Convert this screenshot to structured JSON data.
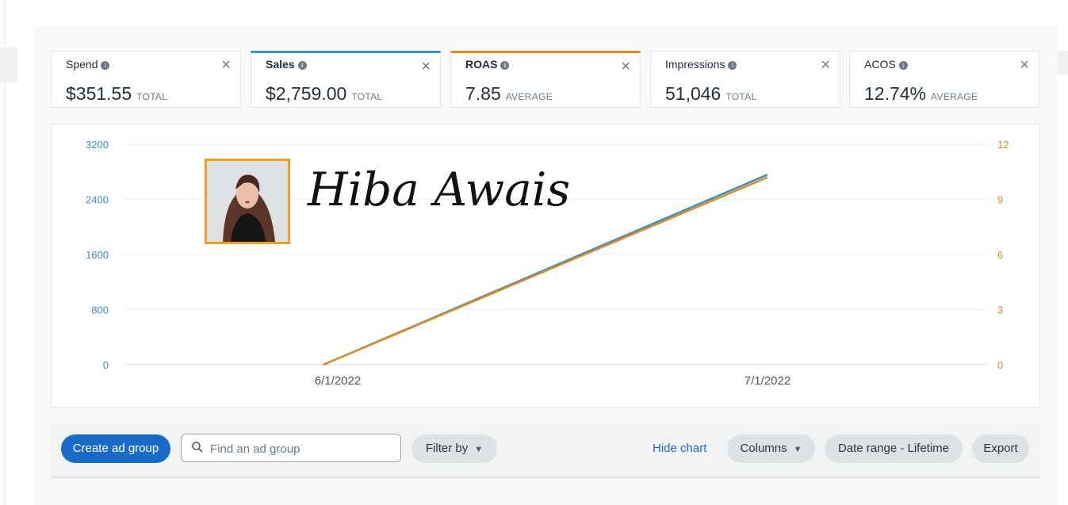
{
  "metrics": [
    {
      "label": "Spend",
      "value": "$351.55",
      "unit": "TOTAL"
    },
    {
      "label": "Sales",
      "value": "$2,759.00",
      "unit": "TOTAL",
      "accent": "#3a90c1"
    },
    {
      "label": "ROAS",
      "value": "7.85",
      "unit": "AVERAGE",
      "accent": "#e08a23"
    },
    {
      "label": "Impressions",
      "value": "51,046",
      "unit": "TOTAL"
    },
    {
      "label": "ACOS",
      "value": "12.74%",
      "unit": "AVERAGE"
    }
  ],
  "chart_data": {
    "type": "line",
    "x": [
      "6/1/2022",
      "7/1/2022"
    ],
    "y_left_ticks": [
      "0",
      "800",
      "1600",
      "2400",
      "3200"
    ],
    "y_right_ticks": [
      "0",
      "3",
      "6",
      "9",
      "12"
    ],
    "ylim_left": [
      0,
      3200
    ],
    "ylim_right": [
      0,
      12
    ],
    "grid": true,
    "series": [
      {
        "name": "Sales",
        "axis": "left",
        "color": "#3a90c1",
        "x": [
          "5/31/2022",
          "7/1/2022"
        ],
        "values": [
          0,
          2759
        ]
      },
      {
        "name": "ROAS",
        "axis": "right",
        "color": "#e08a23",
        "x": [
          "5/31/2022",
          "7/1/2022"
        ],
        "values": [
          0,
          10.2
        ]
      }
    ]
  },
  "watermark": {
    "text": "Hiba Awais"
  },
  "toolbar": {
    "create_label": "Create ad group",
    "search_placeholder": "Find an ad group",
    "filter_label": "Filter by",
    "hide_chart_label": "Hide chart",
    "columns_label": "Columns",
    "date_range_label": "Date range - Lifetime",
    "export_label": "Export"
  },
  "icons": {
    "close": "close-icon",
    "info": "info-icon",
    "search": "search-icon",
    "chevron": "chevron-down-icon"
  }
}
